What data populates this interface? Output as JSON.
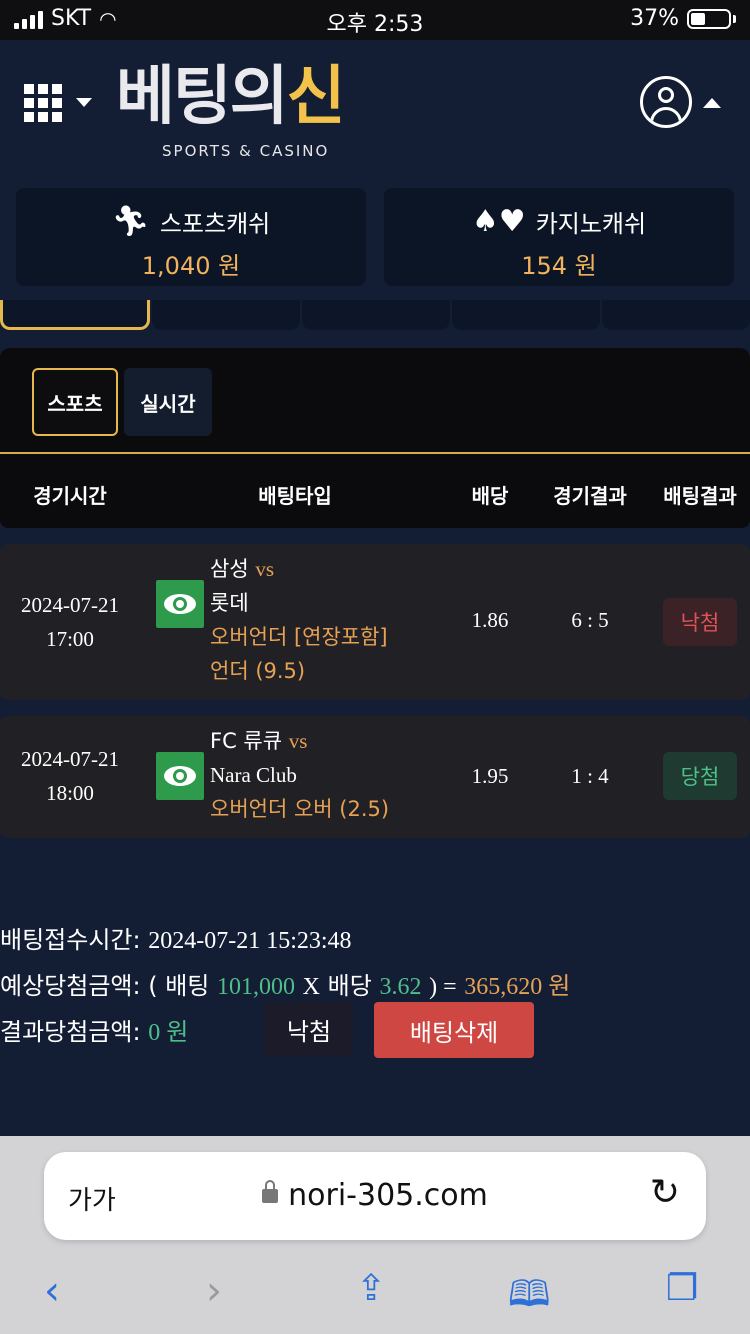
{
  "status": {
    "carrier": "SKT",
    "time": "오후 2:53",
    "battery": "37%"
  },
  "header": {
    "logo_main": "베팅의",
    "logo_accent": "신",
    "logo_sub": "SPORTS & CASINO",
    "menu_icon": "grid-icon",
    "user_icon": "user-icon"
  },
  "cash": {
    "sports": {
      "label": "스포츠캐쉬",
      "amount": "1,040 원",
      "icon": "runner-icon"
    },
    "casino": {
      "label": "카지노캐쉬",
      "amount": "154 원",
      "icon": "cards-icon"
    }
  },
  "subtabs": {
    "sports": "스포츠",
    "live": "실시간"
  },
  "table": {
    "headers": {
      "time": "경기시간",
      "type": "배팅타입",
      "odds": "배당",
      "result": "경기결과",
      "bet_result": "배팅결과"
    },
    "rows": [
      {
        "date": "2024-07-21",
        "time": "17:00",
        "home": "삼성",
        "vs": "vs",
        "away": "롯데",
        "bet_type": "오버언더 [연장포함]",
        "pick": "언더 (9.5)",
        "odds": "1.86",
        "score": "6 : 5",
        "status": "낙첨"
      },
      {
        "date": "2024-07-21",
        "time": "18:00",
        "home": "FC 류큐",
        "vs": "vs",
        "away": "Nara Club",
        "pick": "오버언더 오버 (2.5)",
        "odds": "1.95",
        "score": "1 : 4",
        "status": "당첨"
      }
    ]
  },
  "summary": {
    "received_label": "배팅접수시간:",
    "received_value": "2024-07-21 15:23:48",
    "expected_label": "예상당첨금액:",
    "expected_open": "( 배팅",
    "stake": "101,000",
    "x": "X",
    "odds_label": "배당",
    "total_odds": "3.62",
    "close_eq": ") =",
    "expected_amount": "365,620 원",
    "result_label": "결과당첨금액:",
    "result_amount": "0 원",
    "result_button": "낙첨",
    "delete_button": "배팅삭제"
  },
  "browser": {
    "aa": "가가",
    "url": "nori-305.com"
  },
  "colors": {
    "background": "#131e35",
    "accent_gold": "#e4b84a",
    "win_green": "#4fbf8a",
    "lose_red": "#e05258",
    "delete_red": "#cf4742",
    "orange": "#e7a154"
  }
}
